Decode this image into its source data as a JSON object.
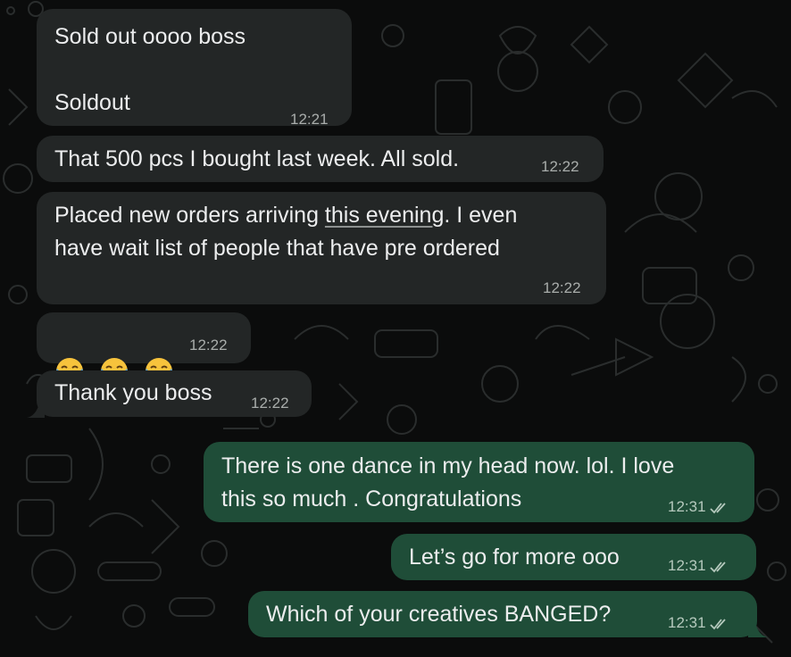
{
  "messages": [
    {
      "direction": "in",
      "text": "Sold out oooo boss\n\nSoldout",
      "time": "12:21"
    },
    {
      "direction": "in",
      "text": "That 500 pcs I bought last week. All sold.",
      "time": "12:22"
    },
    {
      "direction": "in",
      "text_before": "Placed new orders arriving ",
      "text_link": "this evening",
      "text_after": ". I even\nhave wait list of people that have pre ordered",
      "time": "12:22"
    },
    {
      "direction": "in",
      "emoji": [
        "face-with-tears-of-joy",
        "face-with-tears-of-joy",
        "face-with-tears-of-joy"
      ],
      "time": "12:22"
    },
    {
      "direction": "in",
      "text": "Thank you boss",
      "time": "12:22"
    },
    {
      "direction": "out",
      "text": "There is one dance in my head now. lol. I love\nthis so much . Congratulations",
      "time": "12:31",
      "status": "read-double-tick-icon"
    },
    {
      "direction": "out",
      "text": "Let’s go for more ooo",
      "time": "12:31",
      "status": "read-double-tick-icon"
    },
    {
      "direction": "out",
      "text": "Which of your creatives BANGED?",
      "time": "12:31",
      "status": "read-double-tick-icon"
    }
  ],
  "colors": {
    "background": "#0b0c0c",
    "incoming_bubble": "#232626",
    "outgoing_bubble": "#1f4d38",
    "text": "#ecedee"
  }
}
